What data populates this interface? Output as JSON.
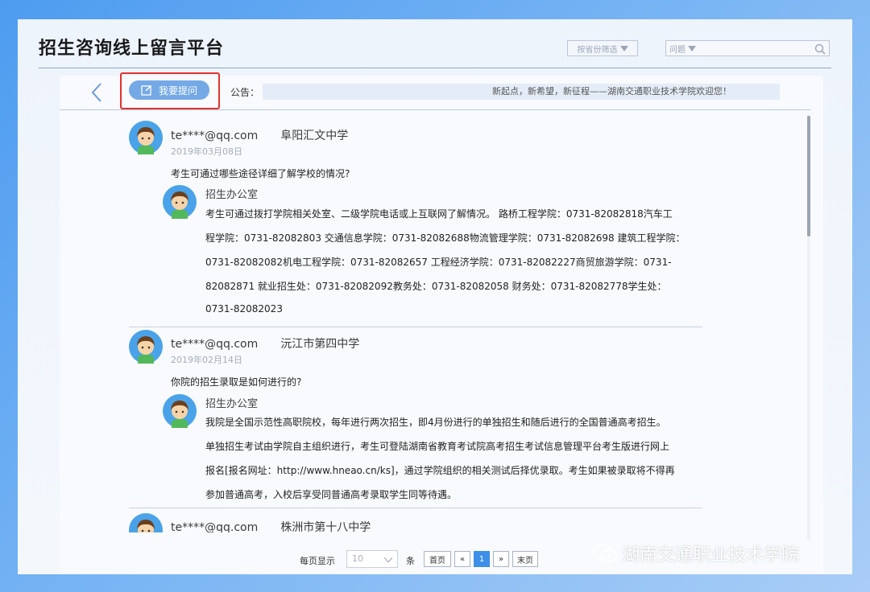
{
  "header": {
    "title": "招生咨询线上留言平台",
    "filter_select": "按省份筛选",
    "search_select": "问题"
  },
  "toolbar": {
    "ask_label": "我要提问",
    "notice_label": "公告：",
    "notice_text": "新起点，新希望，新征程——湖南交通职业技术学院欢迎您！"
  },
  "entries": [
    {
      "user": "te****@qq.com",
      "school": "阜阳汇文中学",
      "date": "2019年03月08日",
      "question": "考生可通过哪些途径详细了解学校的情况?",
      "reply_name": "招生办公室",
      "reply_lines": [
        "考生可通过拨打学院相关处室、二级学院电话或上互联网了解情况。 路桥工程学院：0731-82082818汽车工",
        "程学院：0731-82082803 交通信息学院：0731-82082688物流管理学院：0731-82082698 建筑工程学院：",
        "0731-82082082机电工程学院：0731-82082657 工程经济学院：0731-82082227商贸旅游学院：0731-",
        "82082871 就业招生处：0731-82082092教务处：0731-82082058 财务处：0731-82082778学生处：",
        "0731-82082023"
      ]
    },
    {
      "user": "te****@qq.com",
      "school": "沅江市第四中学",
      "date": "2019年02月14日",
      "question": "你院的招生录取是如何进行的?",
      "reply_name": "招生办公室",
      "reply_lines": [
        "我院是全国示范性高职院校，每年进行两次招生，即4月份进行的单独招生和随后进行的全国普通高考招生。",
        "单独招生考试由学院自主组织进行，考生可登陆湖南省教育考试院高考招生考试信息管理平台考生版进行网上",
        "报名[报名网址：http://www.hneao.cn/ks]，通过学院组织的相关测试后择优录取。考生如果被录取将不得再",
        "参加普通高考，入校后享受同普通高考录取学生同等待遇。"
      ]
    },
    {
      "user": "te****@qq.com",
      "school": "株洲市第十八中学"
    }
  ],
  "pager": {
    "per_page_label": "每页显示",
    "per_page_value": "10",
    "unit_label": "条",
    "first": "首页",
    "prev": "«",
    "current": "1",
    "next": "»",
    "last": "末页"
  },
  "watermark": "湖南交通职业技术学院",
  "colors": {
    "accent": "#3d8fe8",
    "button": "#74a9e6",
    "highlight": "#e5322d"
  }
}
